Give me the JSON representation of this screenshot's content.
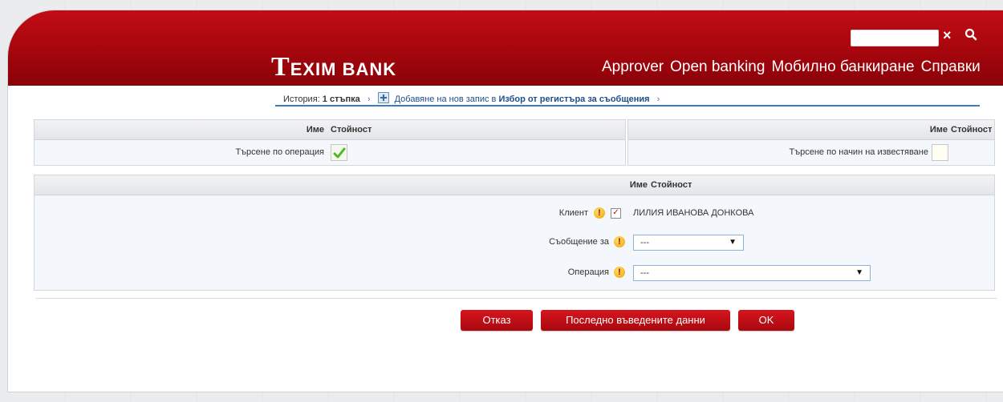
{
  "header": {
    "logo_big": "T",
    "logo_rest": "EXIM BANK",
    "nav": [
      "Approver",
      "Open banking",
      "Мобилно банкиране",
      "Справки"
    ],
    "search": {
      "value": "",
      "clear_label": "×"
    }
  },
  "breadcrumb": {
    "history_label": "История:",
    "steps": "1 стъпка",
    "sep": "›",
    "action_text": "Добавяне на нов запис в",
    "target": "Избор от регистъра за съобщения",
    "sep_end": "›"
  },
  "filter_left": {
    "col_name": "Име",
    "col_value": "Стойност",
    "label": "Търсене по операция",
    "checked": true
  },
  "filter_right": {
    "col_name": "Име",
    "col_value": "Стойност",
    "label": "Търсене по начин на известяване",
    "checked": false
  },
  "form": {
    "col_name": "Име",
    "col_value": "Стойност",
    "client": {
      "label": "Клиент",
      "value": "ЛИЛИЯ ИВАНОВА ДОНКОВА",
      "required_mark": "!",
      "check": "✓"
    },
    "message_for": {
      "label": "Съобщение за",
      "selected": "---",
      "required_mark": "!"
    },
    "operation": {
      "label": "Операция",
      "selected": "---",
      "required_mark": "!"
    }
  },
  "buttons": {
    "cancel": "Отказ",
    "last_entered": "Последно въведените данни",
    "ok": "OK"
  },
  "colors": {
    "brand_red": "#b00a12",
    "link_blue": "#1c4f8e",
    "accent_blue": "#3b7dbf"
  }
}
